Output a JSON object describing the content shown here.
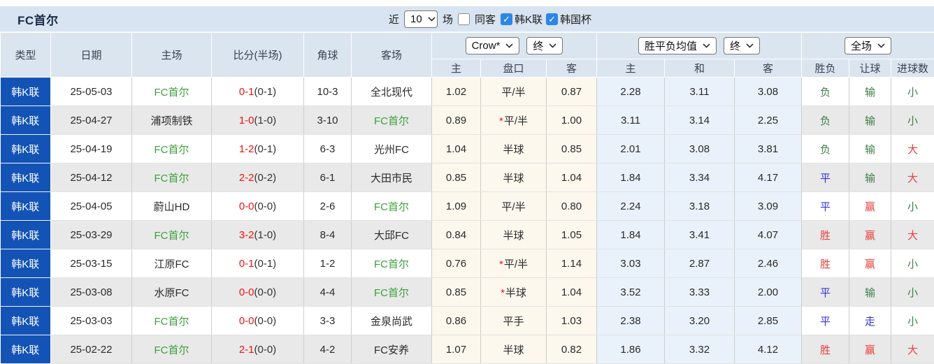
{
  "title": "FC首尔",
  "toolbar": {
    "recent_label": "近",
    "recent_select": "10",
    "matches_label": "场",
    "same_venue_label": "同客",
    "same_venue_checked": false,
    "league_label": "韩K联",
    "league_checked": true,
    "cup_label": "韩国杯",
    "cup_checked": true
  },
  "icons": {
    "check": "✓",
    "chevron_down": "⌄"
  },
  "colors": {
    "type_cell_blue": "#1353b5",
    "bar_background": "#d8e4f1",
    "header_background": "#dbe5f0",
    "row_alternate": "#e9e9e9",
    "odds_column_cream": "#fcf8ee",
    "avg_column_blue": "#e9f2fa",
    "team_highlight_green": "#3f9e3f",
    "score_red": "#f31212",
    "result_red": "#e8403e",
    "result_green": "#3e7e47",
    "result_blue": "#3232e1",
    "checkbox_blue": "#2d86e8"
  },
  "table": {
    "static_headers": [
      "类型",
      "日期",
      "主场",
      "比分(半场)",
      "角球",
      "客场"
    ],
    "groups": [
      {
        "selects": [
          "Crow*",
          "终"
        ],
        "subcols": [
          "主",
          "盘口",
          "客"
        ]
      },
      {
        "selects": [
          "胜平负均值",
          "终"
        ],
        "subcols": [
          "主",
          "和",
          "客"
        ]
      },
      {
        "selects": [
          "全场"
        ],
        "subcols": [
          "胜负",
          "让球",
          "进球数"
        ]
      }
    ]
  },
  "rows": [
    {
      "type": "韩K联",
      "date": "25-05-03",
      "home": "FC首尔",
      "home_hl": true,
      "score": "0-1",
      "half": "(0-1)",
      "corner": "10-3",
      "away": "全北现代",
      "away_hl": false,
      "odds_home": "1.02",
      "handicap": "平/半",
      "handicap_star": false,
      "odds_away": "0.87",
      "avg_win": "2.28",
      "avg_draw": "3.11",
      "avg_lose": "3.08",
      "result": "负",
      "result_color": "green",
      "handicap_result": "输",
      "handicap_result_color": "green",
      "goals": "小",
      "goals_color": "green"
    },
    {
      "type": "韩K联",
      "date": "25-04-27",
      "home": "浦项制铁",
      "home_hl": false,
      "score": "1-0",
      "half": "(1-0)",
      "corner": "3-10",
      "away": "FC首尔",
      "away_hl": true,
      "odds_home": "0.89",
      "handicap": "平/半",
      "handicap_star": true,
      "odds_away": "1.00",
      "avg_win": "3.11",
      "avg_draw": "3.14",
      "avg_lose": "2.25",
      "result": "负",
      "result_color": "green",
      "handicap_result": "输",
      "handicap_result_color": "green",
      "goals": "小",
      "goals_color": "green"
    },
    {
      "type": "韩K联",
      "date": "25-04-19",
      "home": "FC首尔",
      "home_hl": true,
      "score": "1-2",
      "half": "(0-1)",
      "corner": "6-3",
      "away": "光州FC",
      "away_hl": false,
      "odds_home": "1.04",
      "handicap": "半球",
      "handicap_star": false,
      "odds_away": "0.85",
      "avg_win": "2.01",
      "avg_draw": "3.08",
      "avg_lose": "3.81",
      "result": "负",
      "result_color": "green",
      "handicap_result": "输",
      "handicap_result_color": "green",
      "goals": "大",
      "goals_color": "red"
    },
    {
      "type": "韩K联",
      "date": "25-04-12",
      "home": "FC首尔",
      "home_hl": true,
      "score": "2-2",
      "half": "(0-2)",
      "corner": "6-1",
      "away": "大田市民",
      "away_hl": false,
      "odds_home": "0.85",
      "handicap": "半球",
      "handicap_star": false,
      "odds_away": "1.04",
      "avg_win": "1.84",
      "avg_draw": "3.34",
      "avg_lose": "4.17",
      "result": "平",
      "result_color": "blue",
      "handicap_result": "输",
      "handicap_result_color": "green",
      "goals": "大",
      "goals_color": "red"
    },
    {
      "type": "韩K联",
      "date": "25-04-05",
      "home": "蔚山HD",
      "home_hl": false,
      "score": "0-0",
      "half": "(0-0)",
      "corner": "2-6",
      "away": "FC首尔",
      "away_hl": true,
      "odds_home": "1.09",
      "handicap": "平/半",
      "handicap_star": false,
      "odds_away": "0.80",
      "avg_win": "2.24",
      "avg_draw": "3.18",
      "avg_lose": "3.09",
      "result": "平",
      "result_color": "blue",
      "handicap_result": "赢",
      "handicap_result_color": "red",
      "goals": "小",
      "goals_color": "green"
    },
    {
      "type": "韩K联",
      "date": "25-03-29",
      "home": "FC首尔",
      "home_hl": true,
      "score": "3-2",
      "half": "(1-0)",
      "corner": "8-4",
      "away": "大邱FC",
      "away_hl": false,
      "odds_home": "0.84",
      "handicap": "半球",
      "handicap_star": false,
      "odds_away": "1.05",
      "avg_win": "1.84",
      "avg_draw": "3.41",
      "avg_lose": "4.07",
      "result": "胜",
      "result_color": "red",
      "handicap_result": "赢",
      "handicap_result_color": "red",
      "goals": "大",
      "goals_color": "red"
    },
    {
      "type": "韩K联",
      "date": "25-03-15",
      "home": "江原FC",
      "home_hl": false,
      "score": "0-1",
      "half": "(0-1)",
      "corner": "1-2",
      "away": "FC首尔",
      "away_hl": true,
      "odds_home": "0.76",
      "handicap": "平/半",
      "handicap_star": true,
      "odds_away": "1.14",
      "avg_win": "3.03",
      "avg_draw": "2.87",
      "avg_lose": "2.46",
      "result": "胜",
      "result_color": "red",
      "handicap_result": "赢",
      "handicap_result_color": "red",
      "goals": "小",
      "goals_color": "green"
    },
    {
      "type": "韩K联",
      "date": "25-03-08",
      "home": "水原FC",
      "home_hl": false,
      "score": "0-0",
      "half": "(0-0)",
      "corner": "4-4",
      "away": "FC首尔",
      "away_hl": true,
      "odds_home": "0.85",
      "handicap": "半球",
      "handicap_star": true,
      "odds_away": "1.04",
      "avg_win": "3.52",
      "avg_draw": "3.33",
      "avg_lose": "2.00",
      "result": "平",
      "result_color": "blue",
      "handicap_result": "输",
      "handicap_result_color": "green",
      "goals": "小",
      "goals_color": "green"
    },
    {
      "type": "韩K联",
      "date": "25-03-03",
      "home": "FC首尔",
      "home_hl": true,
      "score": "0-0",
      "half": "(0-0)",
      "corner": "3-3",
      "away": "金泉尚武",
      "away_hl": false,
      "odds_home": "0.86",
      "handicap": "平手",
      "handicap_star": false,
      "odds_away": "1.03",
      "avg_win": "2.38",
      "avg_draw": "3.20",
      "avg_lose": "2.85",
      "result": "平",
      "result_color": "blue",
      "handicap_result": "走",
      "handicap_result_color": "blue",
      "goals": "小",
      "goals_color": "green"
    },
    {
      "type": "韩K联",
      "date": "25-02-22",
      "home": "FC首尔",
      "home_hl": true,
      "score": "2-1",
      "half": "(0-0)",
      "corner": "4-2",
      "away": "FC安养",
      "away_hl": false,
      "odds_home": "1.07",
      "handicap": "半球",
      "handicap_star": false,
      "odds_away": "0.82",
      "avg_win": "1.86",
      "avg_draw": "3.32",
      "avg_lose": "4.12",
      "result": "胜",
      "result_color": "red",
      "handicap_result": "赢",
      "handicap_result_color": "red",
      "goals": "大",
      "goals_color": "red"
    }
  ]
}
